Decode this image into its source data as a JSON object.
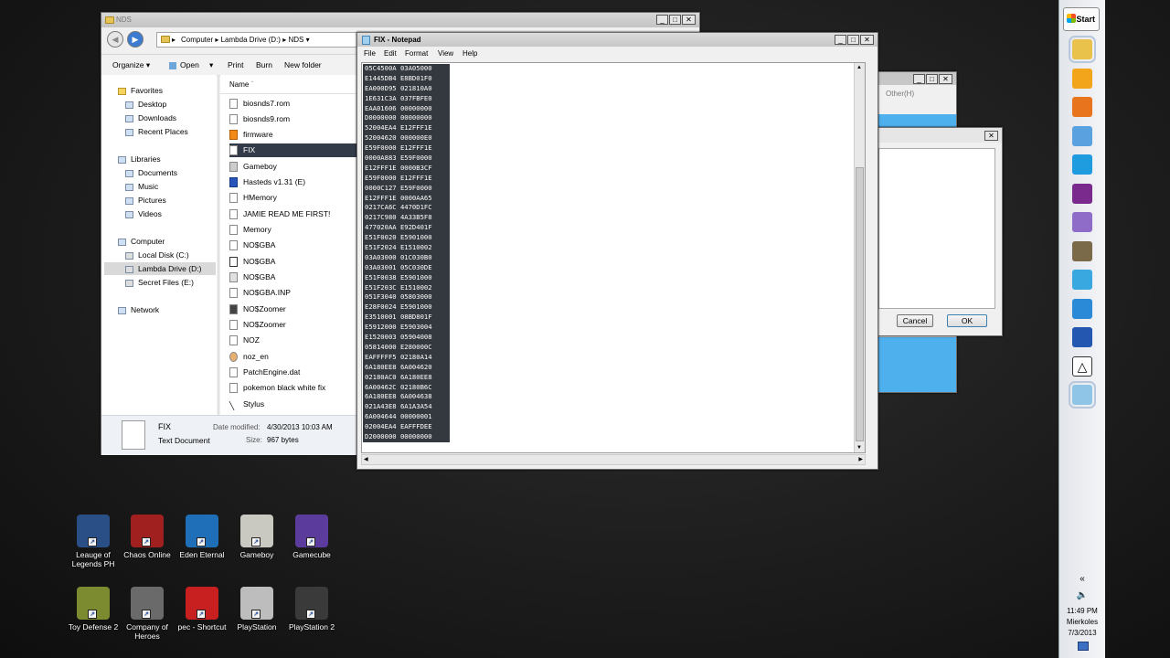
{
  "explorer": {
    "title": "NDS",
    "breadcrumb": [
      "Computer",
      "Lambda Drive (D:)",
      "NDS"
    ],
    "toolbar": {
      "organize": "Organize",
      "open": "Open",
      "print": "Print",
      "burn": "Burn",
      "new_folder": "New folder"
    },
    "nav": {
      "favorites": "Favorites",
      "desktop": "Desktop",
      "downloads": "Downloads",
      "recent": "Recent Places",
      "libraries": "Libraries",
      "documents": "Documents",
      "music": "Music",
      "pictures": "Pictures",
      "videos": "Videos",
      "computer": "Computer",
      "local_disk": "Local Disk (C:)",
      "lambda_drive": "Lambda Drive (D:)",
      "secret_files": "Secret Files (E:)",
      "network": "Network"
    },
    "column_name": "Name",
    "files": [
      "biosnds7.rom",
      "biosnds9.rom",
      "firmware",
      "FIX",
      "Gameboy",
      "Hasteds v1.31 (E)",
      "HMemory",
      "JAMIE READ ME FIRST!",
      "Memory",
      "NO$GBA",
      "NO$GBA",
      "NO$GBA",
      "NO$GBA.INP",
      "NO$Zoomer",
      "NO$Zoomer",
      "NOZ",
      "noz_en",
      "PatchEngine.dat",
      "pokemon black white fix",
      "Stylus"
    ],
    "selected_file": "FIX",
    "details": {
      "name": "FIX",
      "type": "Text Document",
      "modified_label": "Date modified:",
      "modified": "4/30/2013 10:03 AM",
      "size_label": "Size:",
      "size": "967 bytes"
    }
  },
  "notepad": {
    "title": "FIX - Notepad",
    "menu": [
      "File",
      "Edit",
      "Format",
      "View",
      "Help"
    ],
    "lines": [
      "05C4500A 03A05000",
      "E1445DB4 E8BD01F0",
      "EA000D95 021810A0",
      "1E631C3A 037FBFE0",
      "EAA01606 00000000",
      "D0000000 00000000",
      "52004EA4 E12FFF1E",
      "52004620 000000E0",
      "E59F0000 E12FFF1E",
      "0000A883 E59F0000",
      "E12FFF1E 0000B3CF",
      "E59F0000 E12FFF1E",
      "0000C127 E59F0000",
      "E12FFF1E 0000AA65",
      "0217CA6C 4470D1FC",
      "0217C980 4A33B5F8",
      "477020AA E92D401F",
      "E51F0020 E5901000",
      "E51F2024 E1510002",
      "03A03000 01C030B0",
      "03A03001 05C030DE",
      "E51F0038 E5901000",
      "E51F203C E1510002",
      "051F3040 05803000",
      "E28F0024 E5901000",
      "E3510001 08BD801F",
      "E5912000 E5903004",
      "E1520003 05904008",
      "05814000 E280000C",
      "EAFFFFF5 02180A14",
      "6A180EE8 6A004620",
      "02180AC0 6A180EE8",
      "6A00462C 02180B6C",
      "6A180EE8 6A004638",
      "021A43E8 6A1A3A54",
      "6A004644 00000001",
      "02004EA4 EAFFFDEE",
      "D2000000 00000000"
    ]
  },
  "background_dialog": {
    "other": "Other(H)",
    "cancel": "Cancel",
    "ok": "OK"
  },
  "desktop_icons": [
    {
      "label": "Leauge of Legends PH",
      "color": "#2a4f86"
    },
    {
      "label": "Chaos Online",
      "color": "#a02020"
    },
    {
      "label": "Eden Eternal",
      "color": "#1e6fb8"
    },
    {
      "label": "Gameboy",
      "color": "#c9c9c2"
    },
    {
      "label": "Gamecube",
      "color": "#5b3b9c"
    },
    {
      "label": "Toy Defense 2",
      "color": "#7c8a30"
    },
    {
      "label": "Company of Heroes",
      "color": "#6a6a6a"
    },
    {
      "label": "pec - Shortcut",
      "color": "#c82020"
    },
    {
      "label": "PlayStation",
      "color": "#bdbdbd"
    },
    {
      "label": "PlayStation 2",
      "color": "#3a3a3a"
    }
  ],
  "taskbar": {
    "start": "Start",
    "icons": [
      {
        "name": "explorer-icon",
        "color": "#e8c24a"
      },
      {
        "name": "chrome-canary-icon",
        "color": "#f2a51a"
      },
      {
        "name": "firefox-icon",
        "color": "#e8741d"
      },
      {
        "name": "chrome-icon",
        "color": "#5aa1e0"
      },
      {
        "name": "skype-icon",
        "color": "#1f9be0"
      },
      {
        "name": "messenger-icon",
        "color": "#7a2a8c"
      },
      {
        "name": "app-icon",
        "color": "#8e6cc8"
      },
      {
        "name": "game-icon",
        "color": "#7a6a4a"
      },
      {
        "name": "cloud-icon",
        "color": "#3aa8e0"
      },
      {
        "name": "chat-icon",
        "color": "#2a8ad8"
      },
      {
        "name": "nds-icon",
        "color": "#2458b0"
      },
      {
        "name": "nosgba-icon",
        "color": "#ffffff"
      },
      {
        "name": "notepad-icon",
        "color": "#8fc6e8"
      }
    ],
    "tray_expand": "«",
    "time": "11:49 PM",
    "day": "Mierkoles",
    "date": "7/3/2013"
  }
}
